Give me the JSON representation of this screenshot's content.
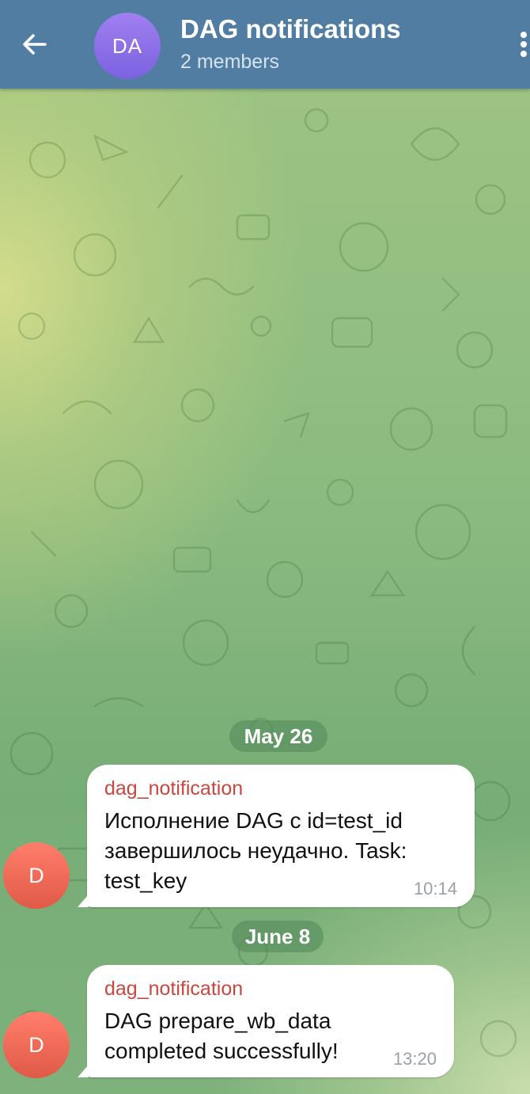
{
  "header": {
    "back_icon": "arrow-left-icon",
    "avatar_initials": "DA",
    "title": "DAG notifications",
    "subtitle": "2 members",
    "menu_icon": "more-vertical-icon",
    "background_color": "#517da2"
  },
  "messages": [
    {
      "date": "May 26",
      "avatar_initial": "D",
      "sender": "dag_notification",
      "text": "Исполнение DAG с id=test_id\nзавершилось неудачно. Task:\ntest_key",
      "time": "10:14"
    },
    {
      "date": "June 8",
      "avatar_initial": "D",
      "sender": "dag_notification",
      "text": "DAG prepare_wb_data\ncompleted successfully!",
      "time": "13:20"
    }
  ],
  "colors": {
    "sender_name": "#c8473f",
    "sender_avatar": "#e86a56",
    "chat_avatar": "#8c6fe8"
  }
}
